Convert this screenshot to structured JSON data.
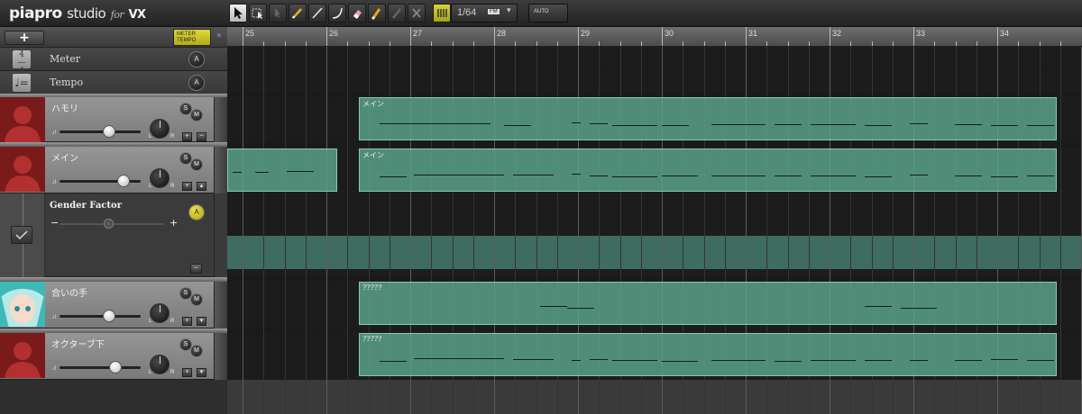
{
  "app": {
    "logo_main": "piapro",
    "logo_studio": "studio",
    "logo_for": "for",
    "logo_vx": "VX"
  },
  "toolbar": {
    "quantize_value": "1/64",
    "quantize_suffix": "FM",
    "auto_label": "AUTO"
  },
  "left_header": {
    "add_label": "+",
    "meter_label": "METER",
    "tempo_label": "TEMPO",
    "collapse_label": "«"
  },
  "master_rows": [
    {
      "label": "Meter",
      "icon": "4/4",
      "auto_btn": "A"
    },
    {
      "label": "Tempo",
      "icon": "quarter-note = ",
      "auto_btn": "A"
    }
  ],
  "tracks": [
    {
      "name": "ハモリ",
      "volume": 0.6,
      "avatar": "silhouette",
      "solo": "S",
      "mute": "M",
      "part_label": "メイン"
    },
    {
      "name": "メイン",
      "volume": 0.78,
      "avatar": "silhouette",
      "solo": "S",
      "mute": "M",
      "part_label": "メイン"
    },
    {
      "name": "合いの手",
      "volume": 0.6,
      "avatar": "miku",
      "solo": "S",
      "mute": "M",
      "part_label": "?????"
    },
    {
      "name": "オクターブ下",
      "volume": 0.68,
      "avatar": "silhouette",
      "solo": "S",
      "mute": "M",
      "part_label": "?????"
    }
  ],
  "gender_factor": {
    "label": "Gender Factor",
    "minus": "−",
    "plus": "+",
    "auto_btn": "A",
    "value": 0.5,
    "collapse": "−"
  },
  "ruler": {
    "measures": [
      "25",
      "26",
      "27",
      "28",
      "29",
      "30",
      "31",
      "32",
      "33",
      "34"
    ]
  },
  "knob_labels": {
    "l": "L",
    "r": "R"
  },
  "colors": {
    "part_fill": "#5ca68e",
    "accent_yellow": "#d8d23a",
    "avatar_red": "#7a1a1a"
  }
}
